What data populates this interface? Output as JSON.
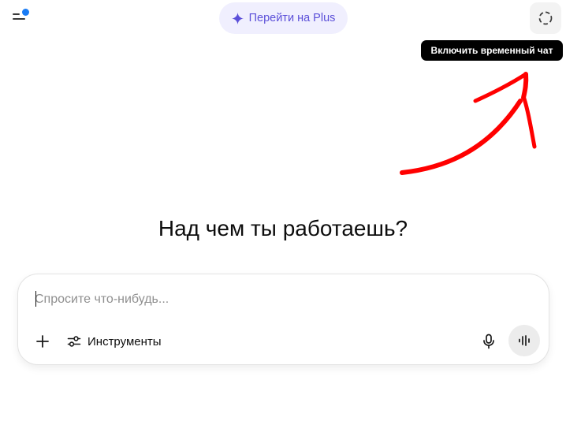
{
  "header": {
    "upgrade_label": "Перейти на Plus",
    "temporary_chat_tooltip": "Включить временный чат",
    "notification_dot_color": "#1a7cf5"
  },
  "main": {
    "headline": "Над чем ты работаешь?"
  },
  "composer": {
    "placeholder": "Спросите что-нибудь...",
    "value": "",
    "tools_label": "Инструменты"
  },
  "icons": {
    "sidebar": "sidebar-toggle-icon",
    "sparkle": "sparkle-icon",
    "temporary_chat": "dashed-circle-icon",
    "add": "plus-icon",
    "tools": "sliders-icon",
    "mic": "microphone-icon",
    "voice": "voice-waveform-icon"
  },
  "colors": {
    "accent": "#5b4fd9",
    "pill_background": "#f0effe",
    "annotation_arrow": "#ff0000",
    "tooltip_background": "#000000"
  }
}
